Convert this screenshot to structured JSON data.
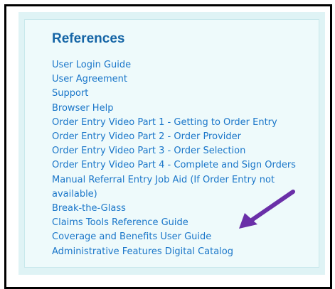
{
  "references": {
    "title": "References",
    "links": [
      "User Login Guide",
      "User Agreement",
      "Support",
      "Browser Help",
      "Order Entry Video Part 1 - Getting to Order Entry",
      "Order Entry Video Part 2 - Order Provider",
      "Order Entry Video Part 3 - Order Selection",
      "Order Entry Video Part 4 - Complete and Sign Orders",
      "Manual Referral Entry Job Aid (If Order Entry not available)",
      "Break-the-Glass",
      "Claims Tools Reference Guide",
      "Coverage and Benefits User Guide",
      "Administrative Features Digital Catalog"
    ]
  },
  "annotation": {
    "icon": "arrow-icon",
    "color": "#6a2fa8"
  },
  "colors": {
    "title": "#1565a6",
    "link": "#1a76c9",
    "panel": "#eefafb",
    "panel_outer": "#dff3f5",
    "frame": "#000000"
  }
}
